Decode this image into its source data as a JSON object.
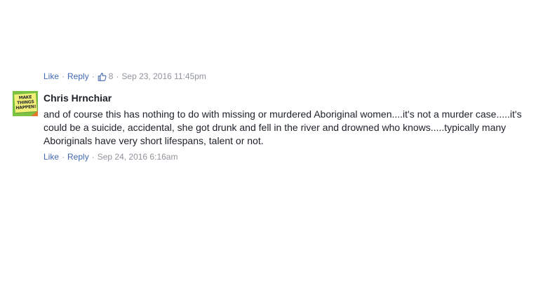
{
  "prev_actions": {
    "like_label": "Like",
    "reply_label": "Reply",
    "like_count": "8",
    "timestamp": "Sep 23, 2016 11:45pm"
  },
  "comment": {
    "author": "Chris Hrnchiar",
    "avatar_text": "MAKE THINGS HAPPEN!",
    "text": "and of course this has nothing to do with missing or murdered Aboriginal women....it's not a murder case.....it's could be a suicide, accidental, she got drunk and fell in the river and drowned who knows.....typically many Aboriginals have very short lifespans, talent or not.",
    "like_label": "Like",
    "reply_label": "Reply",
    "timestamp": "Sep 24, 2016 6:16am"
  },
  "colors": {
    "link": "#4267b2",
    "meta": "#90949c",
    "text": "#1d2129"
  }
}
